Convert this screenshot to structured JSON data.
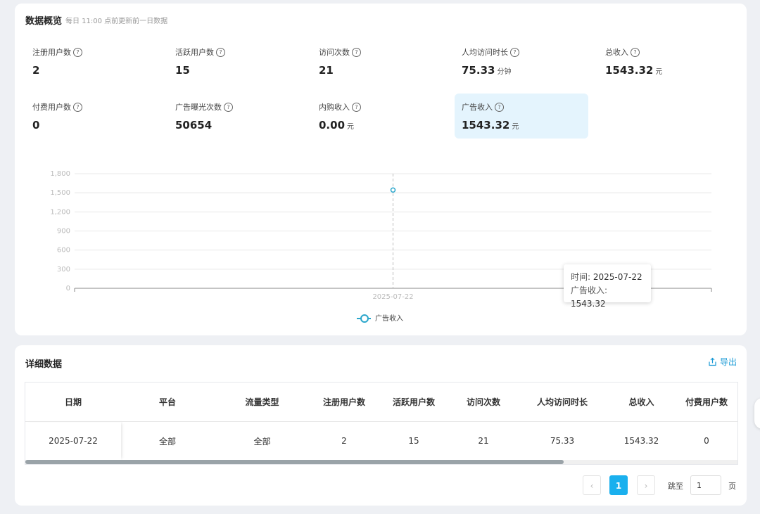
{
  "overview": {
    "title": "数据概览",
    "subtitle": "每日 11:00 点前更新前一日数据",
    "help_glyph": "?",
    "metrics": [
      {
        "label": "注册用户数",
        "value": "2",
        "unit": ""
      },
      {
        "label": "活跃用户数",
        "value": "15",
        "unit": ""
      },
      {
        "label": "访问次数",
        "value": "21",
        "unit": ""
      },
      {
        "label": "人均访问时长",
        "value": "75.33",
        "unit": "分钟"
      },
      {
        "label": "总收入",
        "value": "1543.32",
        "unit": "元"
      },
      {
        "label": "付费用户数",
        "value": "0",
        "unit": ""
      },
      {
        "label": "广告曝光次数",
        "value": "50654",
        "unit": ""
      },
      {
        "label": "内购收入",
        "value": "0.00",
        "unit": "元"
      },
      {
        "label": "广告收入",
        "value": "1543.32",
        "unit": "元"
      }
    ],
    "active_metric": "广告收入"
  },
  "chart_data": {
    "type": "line",
    "x": [
      "2025-07-22"
    ],
    "series": [
      {
        "name": "广告收入",
        "values": [
          1543.32
        ]
      }
    ],
    "yticks": [
      "0",
      "300",
      "600",
      "900",
      "1,200",
      "1,500",
      "1,800"
    ],
    "ylim": [
      0,
      1800
    ],
    "grid": true,
    "legend": "bottom",
    "color": "#2aa6cb",
    "tooltip": {
      "time_label": "时间:",
      "time_value": "2025-07-22",
      "series_label": "广告收入:",
      "series_value": "1543.32"
    }
  },
  "detail": {
    "title": "详细数据",
    "export_label": "导出",
    "columns": [
      "日期",
      "平台",
      "流量类型",
      "注册用户数",
      "活跃用户数",
      "访问次数",
      "人均访问时长",
      "总收入",
      "付费用户数"
    ],
    "rows": [
      [
        "2025-07-22",
        "全部",
        "全部",
        "2",
        "15",
        "21",
        "75.33",
        "1543.32",
        "0"
      ]
    ],
    "scroll_fraction": 0.756
  },
  "pagination": {
    "prev_glyph": "‹",
    "next_glyph": "›",
    "current_page": "1",
    "jump_label": "跳至",
    "jump_value": "1",
    "page_suffix": "页"
  }
}
